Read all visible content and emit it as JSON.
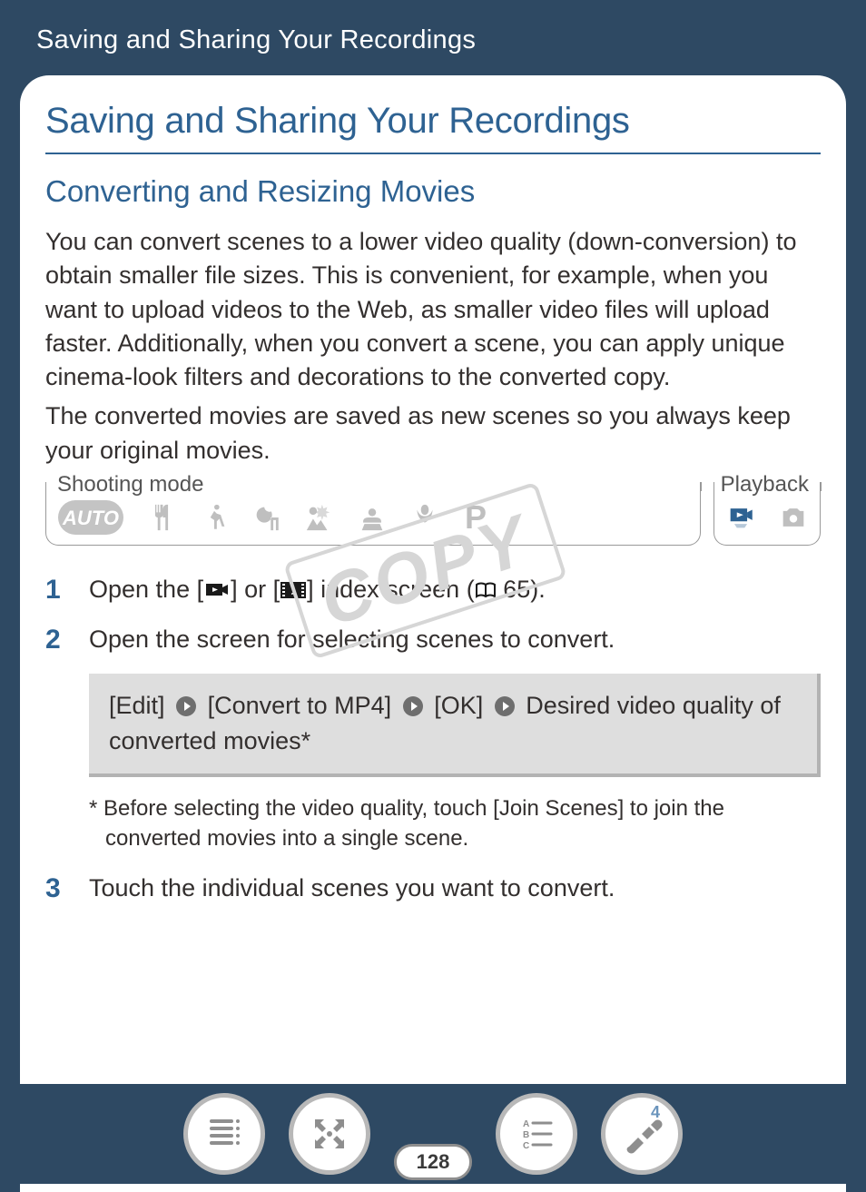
{
  "chapter_title": "Saving and Sharing Your Recordings",
  "main_heading": "Saving and Sharing Your Recordings",
  "sub_heading": "Converting and Resizing Movies",
  "paragraph1": "You can convert scenes to a lower video quality (down-conver­sion) to obtain smaller file sizes. This is convenient, for example, when you want to upload videos to the Web, as smaller video files will upload faster. Additionally, when you convert a scene, you can apply unique cinema-look filters and decorations to the converted copy.",
  "paragraph2": "The converted movies are saved as new scenes so you always keep your original movies.",
  "mode": {
    "shooting_label": "Shooting mode",
    "playback_label": "Playback",
    "auto_text": "AUTO",
    "p_text": "P"
  },
  "steps": {
    "s1": {
      "num": "1",
      "pre": "Open the [",
      "mid": "] or [",
      "post_a": "] index screen (",
      "ref": " 65).",
      "whole_visually": "Open the [movie] or [snapshot] index screen (book 65)."
    },
    "s2": {
      "num": "2",
      "text": "Open the screen for selecting scenes to convert."
    },
    "s3": {
      "num": "3",
      "text": "Touch the individual scenes you want to convert."
    }
  },
  "panel": {
    "seg1": "[Edit]",
    "seg2": "[Convert to MP4]",
    "seg3": "[OK]",
    "seg4": "Desired video quality of converted movies*"
  },
  "footnote": "*  Before selecting the video quality, touch [Join Scenes] to join the converted movies into a single scene.",
  "watermark": "COPY",
  "page_number": "128",
  "toolbar_superscript": "4"
}
